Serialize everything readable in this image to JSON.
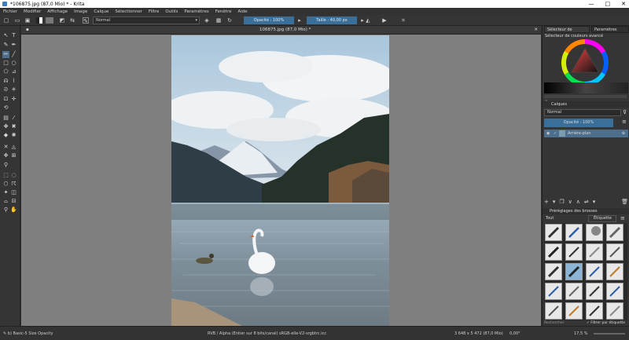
{
  "window": {
    "title": "*106875.jpg (87,0 Mio) * - Krita",
    "controls": [
      "—",
      "□",
      "✕"
    ]
  },
  "menu": [
    "Fichier",
    "Modifier",
    "Affichage",
    "Image",
    "Calque",
    "Sélectionner",
    "Filtre",
    "Outils",
    "Paramètres",
    "Fenêtre",
    "Aide"
  ],
  "toolbar": {
    "blend_mode": "Normal",
    "opacity_label": "Opacité : 100%",
    "size_label": "Taille : 40,00 px"
  },
  "document": {
    "tab_title": "106875.jpg (87,0 Mio) *",
    "close": "✕"
  },
  "right_dock": {
    "tabs": [
      "Sélecteur de couleurs avancé",
      "Paramètres de..."
    ],
    "color_panel_title": "Sélecteur de couleurs avancé",
    "layers_title": "Calques",
    "layers_blend": "Normal",
    "layers_opacity": "Opacité : 100%",
    "layer_name": "Arrière-plan",
    "presets_title": "Préréglages des brosses",
    "presets_filter_label": "Tout",
    "presets_tag_label": "Étiquette",
    "search_placeholder": "Rechercher",
    "filter_checkbox_label": "Filtrer par étiquette"
  },
  "status": {
    "left": "b) Basic-5 Size Opacity",
    "center": "RVB / Alpha (Entier sur 8 bits/canal) sRGB-elle-V2-srgbtrc.icc",
    "dims": "3 648 x 5 472 (87,0 Mio)",
    "rotation": "0,00°",
    "zoom": "17,5 %"
  },
  "colors": {
    "accent": "#3a6f99",
    "canvas_bg": "#7f7f7f",
    "panel_bg": "#353535"
  }
}
